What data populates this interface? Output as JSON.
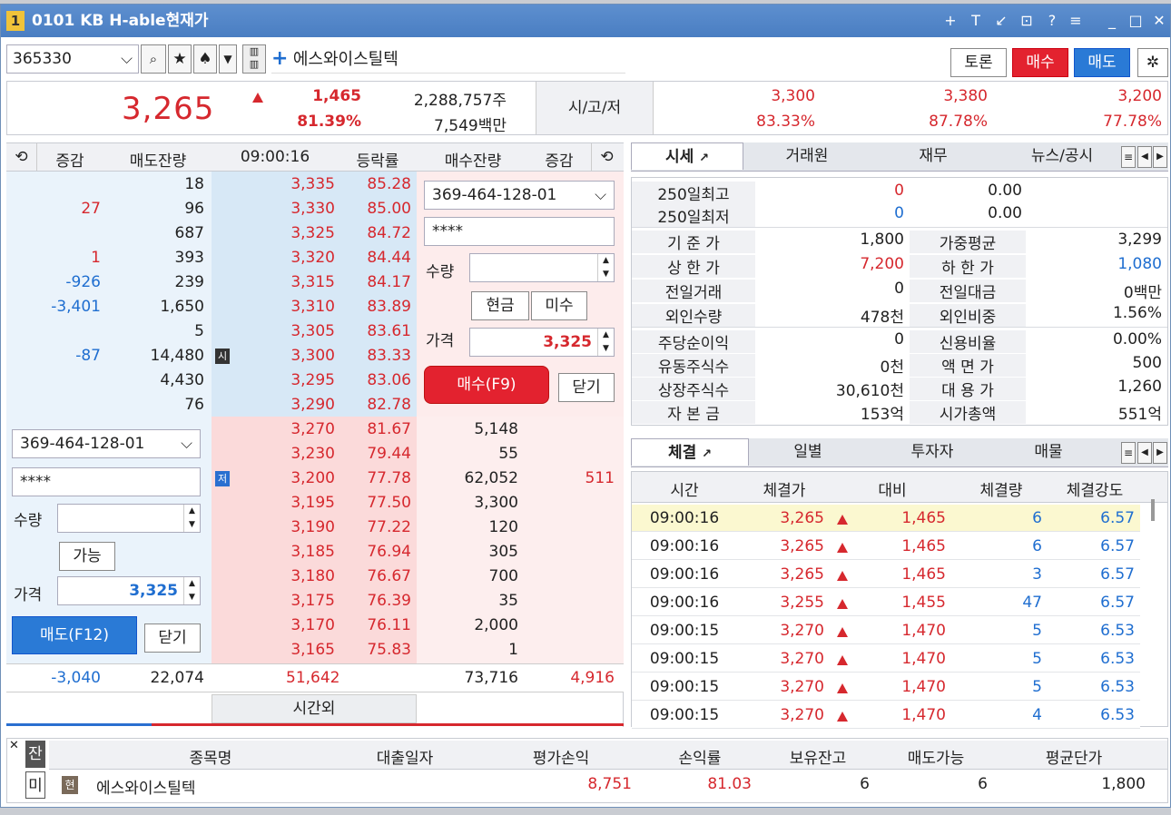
{
  "window": {
    "num": "1",
    "title": "0101 KB H-able현재가",
    "tools": [
      "+",
      "T",
      "↙",
      "⊡",
      "?",
      "≡",
      "_",
      "□",
      "✕"
    ]
  },
  "toolbar": {
    "code": "365330",
    "name": "에스와이스틸텍",
    "btn_talk": "토론",
    "btn_buy": "매수",
    "btn_sell": "매도"
  },
  "quote": {
    "price": "3,265",
    "change": "1,465",
    "rate": "81.39%",
    "volume": "2,288,757주",
    "amount": "7,549백만",
    "ohl_label": "시/고/저",
    "open": "3,300",
    "open_rate": "83.33%",
    "high": "3,380",
    "high_rate": "87.78%",
    "low": "3,200",
    "low_rate": "77.78%"
  },
  "orderbook": {
    "headers": [
      "증감",
      "매도잔량",
      "09:00:16",
      "등락률",
      "매수잔량",
      "증감"
    ],
    "asks": [
      {
        "chg": "",
        "qty": "18",
        "price": "3,335",
        "rate": "85.28"
      },
      {
        "chg": "27",
        "qty": "96",
        "price": "3,330",
        "rate": "85.00"
      },
      {
        "chg": "",
        "qty": "687",
        "price": "3,325",
        "rate": "84.72"
      },
      {
        "chg": "1",
        "qty": "393",
        "price": "3,320",
        "rate": "84.44"
      },
      {
        "chg": "-926",
        "qty": "239",
        "price": "3,315",
        "rate": "84.17"
      },
      {
        "chg": "-3,401",
        "qty": "1,650",
        "price": "3,310",
        "rate": "83.89"
      },
      {
        "chg": "",
        "qty": "5",
        "price": "3,305",
        "rate": "83.61"
      },
      {
        "chg": "-87",
        "qty": "14,480",
        "price": "3,300",
        "rate": "83.33",
        "tag": "시"
      },
      {
        "chg": "",
        "qty": "4,430",
        "price": "3,295",
        "rate": "83.06"
      },
      {
        "chg": "",
        "qty": "76",
        "price": "3,290",
        "rate": "82.78"
      }
    ],
    "bids": [
      {
        "price": "3,270",
        "rate": "81.67",
        "qty": "5,148",
        "chg": ""
      },
      {
        "price": "3,230",
        "rate": "79.44",
        "qty": "55",
        "chg": ""
      },
      {
        "price": "3,200",
        "rate": "77.78",
        "qty": "62,052",
        "chg": "511",
        "tag": "저"
      },
      {
        "price": "3,195",
        "rate": "77.50",
        "qty": "3,300",
        "chg": ""
      },
      {
        "price": "3,190",
        "rate": "77.22",
        "qty": "120",
        "chg": ""
      },
      {
        "price": "3,185",
        "rate": "76.94",
        "qty": "305",
        "chg": ""
      },
      {
        "price": "3,180",
        "rate": "76.67",
        "qty": "700",
        "chg": ""
      },
      {
        "price": "3,175",
        "rate": "76.39",
        "qty": "35",
        "chg": ""
      },
      {
        "price": "3,170",
        "rate": "76.11",
        "qty": "2,000",
        "chg": ""
      },
      {
        "price": "3,165",
        "rate": "75.83",
        "qty": "1",
        "chg": ""
      }
    ],
    "totals": {
      "ask_chg": "-3,040",
      "ask_qty": "22,074",
      "diff": "51,642",
      "bid_qty": "73,716",
      "bid_chg": "4,916"
    },
    "after_hours": "시간외"
  },
  "buy_form": {
    "account": "369-464-128-01",
    "password": "****",
    "qty_label": "수량",
    "cash": "현금",
    "credit": "미수",
    "price_label": "가격",
    "price": "3,325",
    "buy_btn": "매수(F9)",
    "close": "닫기"
  },
  "sell_form": {
    "account": "369-464-128-01",
    "password": "****",
    "qty_label": "수량",
    "avail": "가능",
    "price_label": "가격",
    "price": "3,325",
    "sell_btn": "매도(F12)",
    "close": "닫기"
  },
  "info_tabs": [
    "시세",
    "거래원",
    "재무",
    "뉴스/공시"
  ],
  "info": {
    "rows1": [
      [
        "250일최고",
        "0",
        "0.00"
      ],
      [
        "250일최저",
        "0",
        "0.00"
      ]
    ],
    "rows2": [
      [
        "기 준 가",
        "1,800",
        "가중평균",
        "3,299"
      ],
      [
        "상 한 가",
        "7,200",
        "하 한 가",
        "1,080"
      ],
      [
        "전일거래",
        "0",
        "전일대금",
        "0백만"
      ],
      [
        "외인수량",
        "478천",
        "외인비중",
        "1.56%"
      ]
    ],
    "rows3": [
      [
        "주당순이익",
        "0",
        "신용비율",
        "0.00%"
      ],
      [
        "유동주식수",
        "0천",
        "액 면 가",
        "500"
      ],
      [
        "상장주식수",
        "30,610천",
        "대 용 가",
        "1,260"
      ],
      [
        "자 본 금",
        "153억",
        "시가총액",
        "551억"
      ]
    ]
  },
  "trade_tabs": [
    "체결",
    "일별",
    "투자자",
    "매물"
  ],
  "trades": {
    "headers": [
      "시간",
      "체결가",
      "대비",
      "체결량",
      "체결강도"
    ],
    "rows": [
      [
        "09:00:16",
        "3,265",
        "1,465",
        "6",
        "6.57"
      ],
      [
        "09:00:16",
        "3,265",
        "1,465",
        "6",
        "6.57"
      ],
      [
        "09:00:16",
        "3,265",
        "1,465",
        "3",
        "6.57"
      ],
      [
        "09:00:16",
        "3,255",
        "1,455",
        "47",
        "6.57"
      ],
      [
        "09:00:15",
        "3,270",
        "1,470",
        "5",
        "6.53"
      ],
      [
        "09:00:15",
        "3,270",
        "1,470",
        "5",
        "6.53"
      ],
      [
        "09:00:15",
        "3,270",
        "1,470",
        "5",
        "6.53"
      ],
      [
        "09:00:15",
        "3,270",
        "1,470",
        "4",
        "6.53"
      ]
    ]
  },
  "holdings": {
    "side": [
      "잔",
      "미"
    ],
    "headers": [
      "종목명",
      "대출일자",
      "평가손익",
      "손익률",
      "보유잔고",
      "매도가능",
      "평균단가"
    ],
    "row": {
      "tag": "현",
      "name": "에스와이스틸텍",
      "loan": "",
      "pnl": "8,751",
      "rate": "81.03",
      "hold": "6",
      "sellable": "6",
      "avg": "1,800"
    }
  }
}
